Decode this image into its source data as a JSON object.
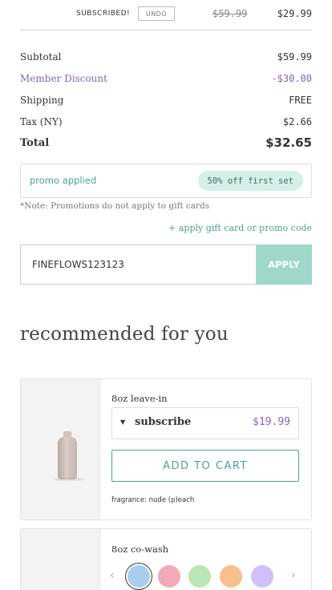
{
  "subscription": {
    "label": "SUBSCRIBED!",
    "undo_label": "UNDO",
    "old_price": "$59.99",
    "new_price": "$29.99"
  },
  "summary": {
    "subtotal_label": "Subtotal",
    "subtotal_value": "$59.99",
    "discount_label": "Member Discount",
    "discount_value": "-$30.00",
    "shipping_label": "Shipping",
    "shipping_value": "FREE",
    "tax_label": "Tax (NY)",
    "tax_value": "$2.66",
    "total_label": "Total",
    "total_value": "$32.65"
  },
  "promo": {
    "applied_text": "promo applied",
    "badge": "50% off first set",
    "note": "*Note: Promotions do not apply to gift cards",
    "apply_link": "+ apply gift card or promo code",
    "code_value": "FINEFLOWS123123",
    "apply_button": "APPLY"
  },
  "recommended": {
    "heading": "recommended for you",
    "products": [
      {
        "title": "8oz leave-in",
        "option": "subscribe",
        "price": "$19.99",
        "cart_label": "ADD TO CART",
        "fragrance": "fragrance: nude (p)each",
        "icon": "chevron-down-icon"
      },
      {
        "title": "8oz co-wash",
        "prev_icon": "‹",
        "next_icon": "›",
        "swatches": [
          "#a8cdf0",
          "#f2a9b8",
          "#b8e6b4",
          "#f8c08d",
          "#cfc0fb"
        ]
      }
    ]
  },
  "colors": {
    "accent_teal": "#4aa196",
    "purple": "#8a63b8",
    "apply_bg": "#9fd8cb"
  }
}
